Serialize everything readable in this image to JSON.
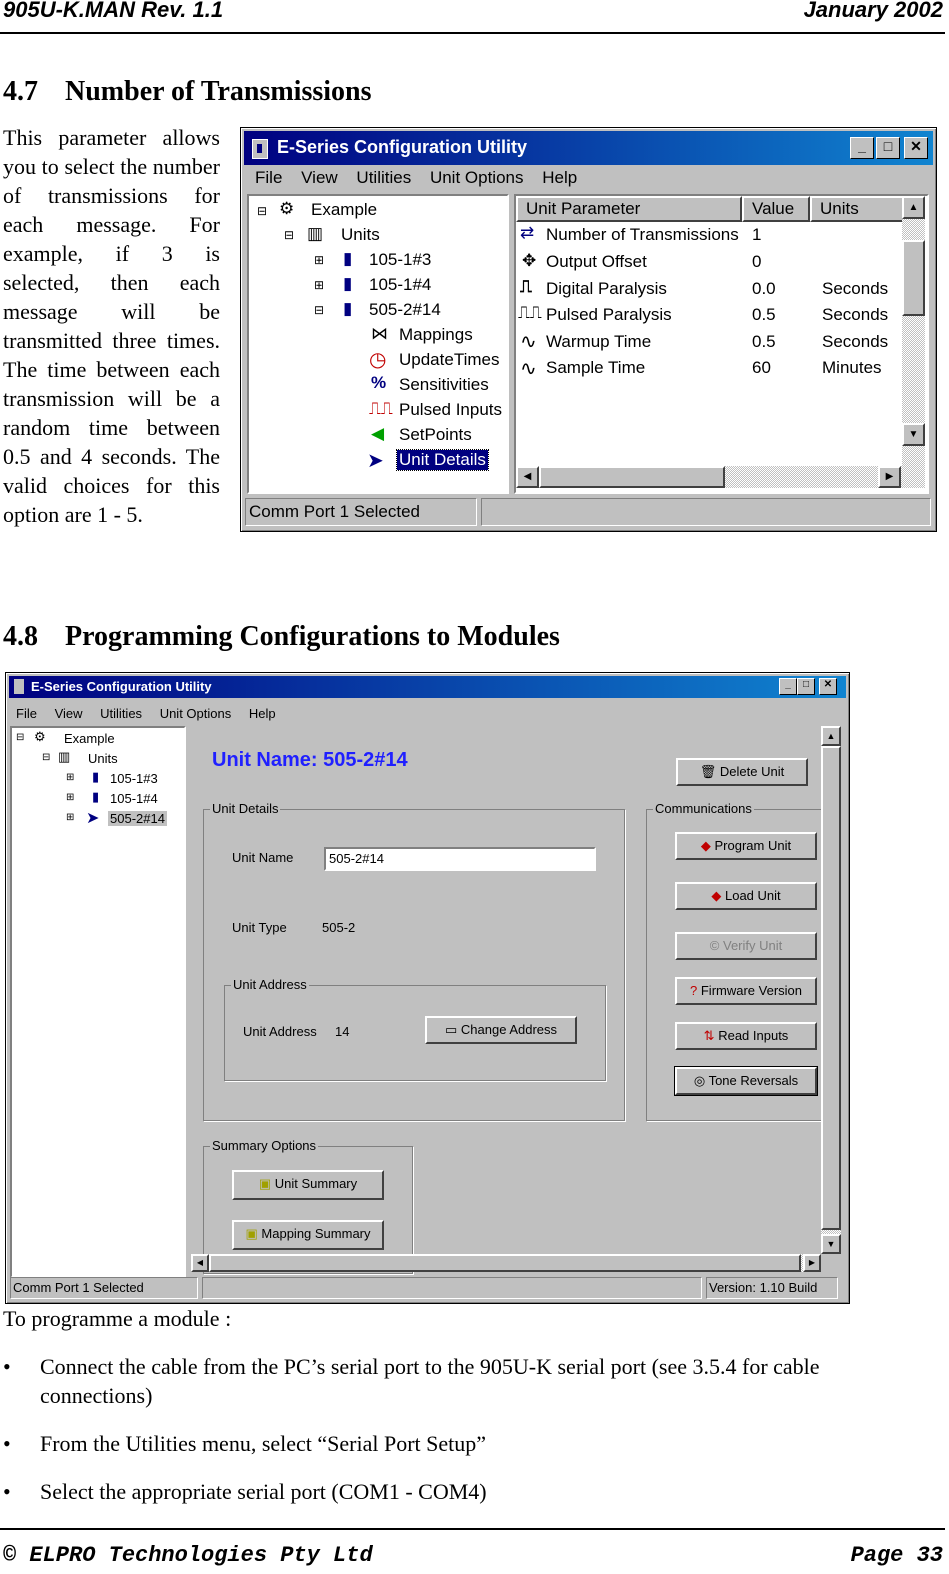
{
  "header": {
    "left": "905U-K.MAN Rev. 1.1",
    "right": "January 2002"
  },
  "section47": {
    "num": "4.7",
    "title": "Number of Transmissions",
    "text": "This parameter allows you to select the number of transmissions for each message. For example, if 3 is selected, then each message will be transmitted three times. The time between each transmission will be a random time between 0.5 and 4 seconds. The valid choices for this option are 1 - 5."
  },
  "win1": {
    "title": "E-Series Configuration Utility",
    "menu": [
      "File",
      "View",
      "Utilities",
      "Unit Options",
      "Help"
    ],
    "tree": [
      "Example",
      "Units",
      "105-1#3",
      "105-1#4",
      "505-2#14",
      "Mappings",
      "UpdateTimes",
      "Sensitivities",
      "Pulsed Inputs",
      "SetPoints",
      "Unit Details"
    ],
    "columns": [
      "Unit Parameter",
      "Value",
      "Units"
    ],
    "rows": [
      {
        "param": "Number of Transmissions",
        "value": "1",
        "units": ""
      },
      {
        "param": "Output Offset",
        "value": "0",
        "units": ""
      },
      {
        "param": "Digital Paralysis",
        "value": "0.0",
        "units": "Seconds"
      },
      {
        "param": "Pulsed Paralysis",
        "value": "0.5",
        "units": "Seconds"
      },
      {
        "param": "Warmup Time",
        "value": "0.5",
        "units": "Seconds"
      },
      {
        "param": "Sample Time",
        "value": "60",
        "units": "Minutes"
      }
    ],
    "status": "Comm Port 1 Selected"
  },
  "section48": {
    "num": "4.8",
    "title": "Programming Configurations to Modules"
  },
  "win2": {
    "title": "E-Series Configuration Utility",
    "menu": [
      "File",
      "View",
      "Utilities",
      "Unit Options",
      "Help"
    ],
    "tree": [
      "Example",
      "Units",
      "105-1#3",
      "105-1#4",
      "505-2#14"
    ],
    "unit_name_heading": "Unit Name: 505-2#14",
    "unit_details_label": "Unit Details",
    "unit_name_label": "Unit Name",
    "unit_name_value": "505-2#14",
    "unit_type_label": "Unit Type",
    "unit_type_value": "505-2",
    "unit_address_group": "Unit Address",
    "unit_address_label": "Unit Address",
    "unit_address_value": "14",
    "change_address": "Change Address",
    "communications_label": "Communications",
    "delete_unit": "Delete Unit",
    "program_unit": "Program Unit",
    "load_unit": "Load Unit",
    "verify_unit": "Verify Unit",
    "firmware_version": "Firmware Version",
    "read_inputs": "Read Inputs",
    "tone_reversals": "Tone Reversals",
    "summary_options": "Summary Options",
    "unit_summary": "Unit Summary",
    "mapping_summary": "Mapping Summary",
    "status": "Comm Port 1 Selected",
    "version": "Version: 1.10 Build"
  },
  "body": {
    "intro": "To programme a module :",
    "bullets": [
      "Connect the cable from the PC’s serial port to the 905U-K serial port (see 3.5.4 for cable",
      "connections)",
      "From the Utilities menu, select “Serial Port Setup”",
      "Select the appropriate serial port (COM1 - COM4)"
    ],
    "bullet_char": "•"
  },
  "footer": {
    "left": "© ELPRO Technologies Pty Ltd",
    "right": "Page 33"
  }
}
